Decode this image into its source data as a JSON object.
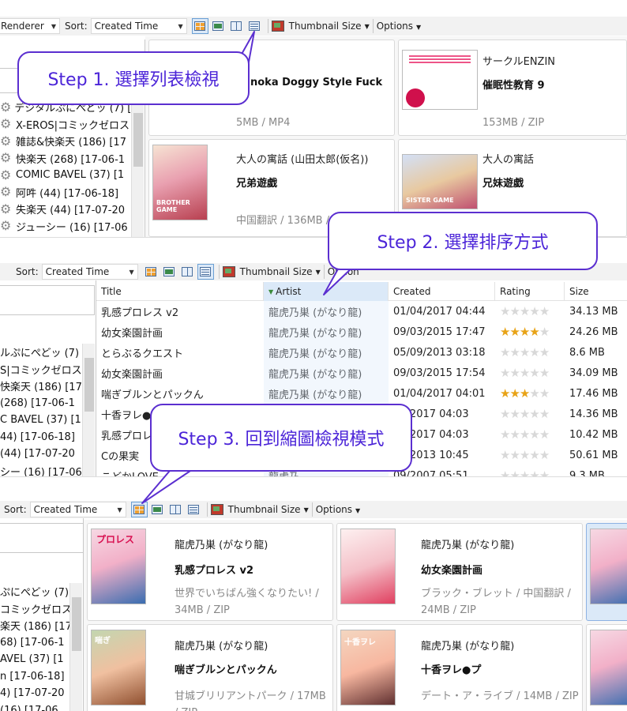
{
  "toolbar1": {
    "renderer": "Renderer",
    "sort_label": "Sort:",
    "sort_value": "Created Time",
    "thumb_size": "Thumbnail Size",
    "options": "Options"
  },
  "toolbar2": {
    "sort_label": "Sort:",
    "sort_value": "Created Time",
    "thumb_size": "Thumbnail Size",
    "options": "Option"
  },
  "toolbar3": {
    "sort_label": "Sort:",
    "sort_value": "Created Time",
    "thumb_size": "Thumbnail Size",
    "options": "Options"
  },
  "callouts": {
    "step1": "Step 1. 選擇列表檢視",
    "step2": "Step 2. 選擇排序方式",
    "step3": "Step 3. 回到縮圖檢視模式"
  },
  "tree1": [
    "デジタルぷにぺどッ (7) [1",
    "X-EROS|コミックゼロス",
    "雑誌&快楽天 (186) [17",
    "快楽天 (268) [17-06-1",
    "COMIC BAVEL (37) [1",
    "阿吽 (44) [17-06-18]",
    "失楽天 (44) [17-07-20",
    "ジューシー (16) [17-06"
  ],
  "tree2": [
    "ルぷにぺどッ (7) [",
    "S|コミックゼロス",
    "快楽天 (186) [17",
    " (268) [17-06-1",
    "C BAVEL (37) [1",
    "44) [17-06-18]",
    " (44) [17-07-20",
    "シー (16) [17-06"
  ],
  "tree3": [
    "ぷにぺどッ (7) [",
    "コミックゼロス",
    "楽天 (186) [17",
    "68) [17-06-1",
    "AVEL (37) [1",
    "n [17-06-18]",
    "4) [17-07-20",
    "(16) [17-06"
  ],
  "grid1": [
    {
      "artist": "",
      "title": "noka Doggy Style Fuck",
      "meta": "5MB / MP4"
    },
    {
      "artist": "サークルENZIN",
      "title": "催眠性教育 9",
      "meta": "153MB / ZIP"
    },
    {
      "artist": "大人の寓話 (山田太郎(仮名))",
      "title": "兄弟遊戯",
      "meta": "中国翻訳 / 136MB / ZIP"
    },
    {
      "artist": "大人の寓話",
      "title": "兄妹遊戯",
      "meta": ""
    }
  ],
  "cover_text": {
    "c1": "BROTHER GAME",
    "c2": "SISTER GAME",
    "c3": "プロレス",
    "c4": "喘ぎ",
    "c5": "十香ヲレ"
  },
  "table": {
    "headers": [
      "Title",
      "Artist",
      "Created",
      "Rating",
      "Size"
    ],
    "rows": [
      {
        "title": "乳感プロレス v2",
        "artist": "龍虎乃巣 (がなり龍)",
        "created": "01/04/2017 04:44",
        "rating": 0,
        "size": "34.13 MB"
      },
      {
        "title": "幼女楽園計画",
        "artist": "龍虎乃巣 (がなり龍)",
        "created": "09/03/2015 17:47",
        "rating": 4,
        "size": "24.26 MB"
      },
      {
        "title": "とらぶるクエスト",
        "artist": "龍虎乃巣 (がなり龍)",
        "created": "05/09/2013 03:18",
        "rating": 0,
        "size": "8.6 MB"
      },
      {
        "title": "幼女楽園計画",
        "artist": "龍虎乃巣 (がなり龍)",
        "created": "09/03/2015 17:54",
        "rating": 0,
        "size": "34.09 MB"
      },
      {
        "title": "喘ぎブルンとパックん",
        "artist": "龍虎乃巣 (がなり龍)",
        "created": "01/04/2017 04:01",
        "rating": 3,
        "size": "17.46 MB"
      },
      {
        "title": "十香ヲレ●",
        "artist": "",
        "created": "04/2017 04:03",
        "rating": 0,
        "size": "14.36 MB"
      },
      {
        "title": "乳感プロレ",
        "artist": "",
        "created": "04/2017 04:03",
        "rating": 0,
        "size": "10.42 MB"
      },
      {
        "title": "Cの果実",
        "artist": "",
        "created": "02/2013 10:45",
        "rating": 0,
        "size": "50.61 MB"
      },
      {
        "title": "こどかLOVE",
        "artist": "龍虎乃",
        "created": "09/2007 05:51",
        "rating": 0,
        "size": "9.3 MB"
      }
    ]
  },
  "grid3": [
    {
      "artist": "龍虎乃巣 (がなり龍)",
      "title": "乳感プロレス v2",
      "meta": "世界でいちばん強くなりたい! / 34MB / ZIP"
    },
    {
      "artist": "龍虎乃巣 (がなり龍)",
      "title": "幼女楽園計画",
      "meta": "ブラック・ブレット / 中国翻訳 / 24MB / ZIP"
    },
    {
      "artist": "龍虎乃巣 (がなり龍)",
      "title": "喘ぎブルンとパックん",
      "meta": "甘城ブリリアントパーク / 17MB / ZIP"
    },
    {
      "artist": "龍虎乃巣 (がなり龍)",
      "title": "十香ヲレ●プ",
      "meta": "デート・ア・ライブ / 14MB / ZIP"
    }
  ]
}
